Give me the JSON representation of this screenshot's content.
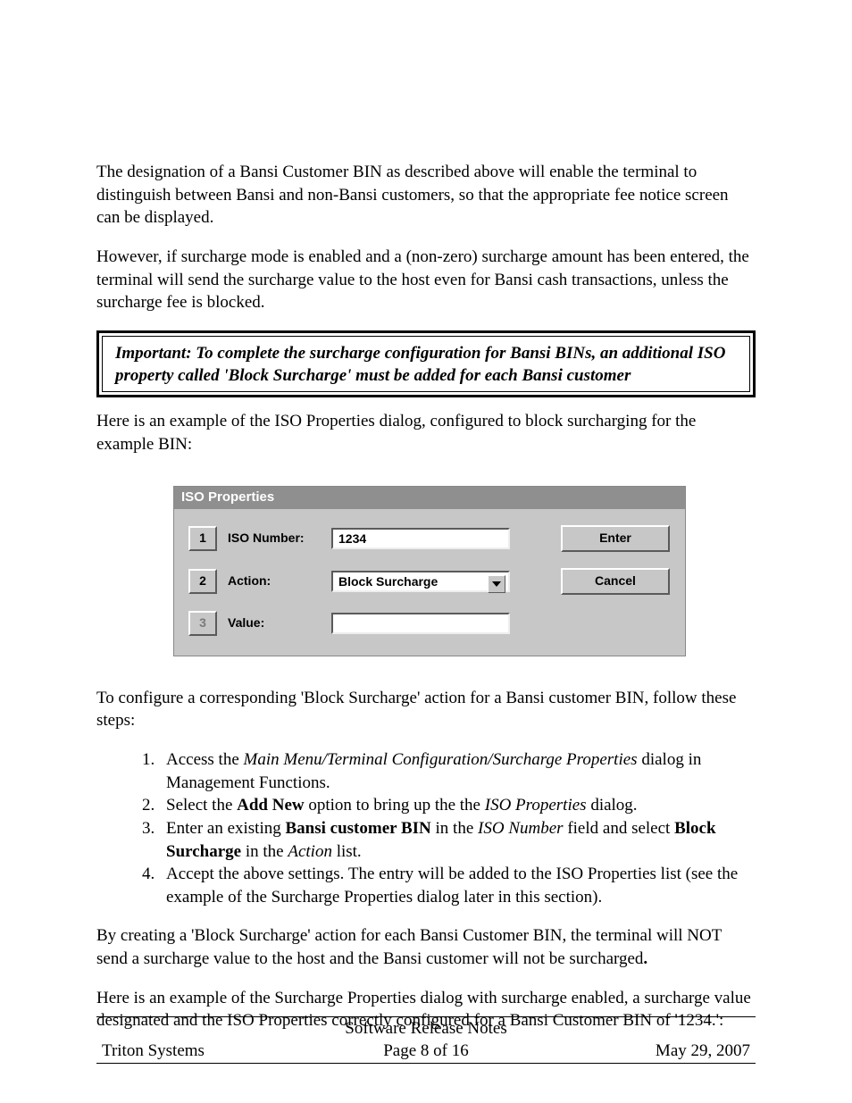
{
  "body": {
    "p1": "The designation of a Bansi Customer BIN as described above will enable the terminal to distinguish between Bansi and non-Bansi customers, so that the appropriate fee notice screen can be displayed.",
    "p2": "However, if surcharge mode is enabled and a (non-zero) surcharge amount has been entered, the terminal will send the surcharge value to the host even for Bansi cash transactions, unless the surcharge fee is blocked.",
    "callout": "Important: To complete the surcharge configuration for Bansi BINs, an additional ISO property called 'Block Surcharge' must be added for each Bansi customer",
    "p3": "Here is an example of the ISO Properties dialog, configured to block surcharging for the example BIN:",
    "p4": "To configure a corresponding 'Block Surcharge' action for a Bansi customer BIN, follow these steps:",
    "p5_a": "By creating a 'Block Surcharge' action for each Bansi Customer BIN, the terminal will NOT send a surcharge value to the host and the Bansi customer will not be surcharged",
    "p5_b": ".",
    "p6": "Here is an example of the Surcharge Properties dialog with surcharge enabled, a surcharge value designated and the ISO Properties correctly configured for a Bansi Customer BIN of '1234.':"
  },
  "steps": {
    "s1_a": "Access the ",
    "s1_b": "Main Menu/Terminal Configuration/Surcharge Properties",
    "s1_c": " dialog in Management Functions.",
    "s2_a": "Select the ",
    "s2_b": "Add New",
    "s2_c": " option to bring up the the ",
    "s2_d": "ISO Properties",
    "s2_e": " dialog.",
    "s3_a": "Enter an existing ",
    "s3_b": "Bansi customer BIN",
    "s3_c": " in the ",
    "s3_d": "ISO Number",
    "s3_e": " field and select ",
    "s3_f": "Block Surcharge",
    "s3_g": " in the ",
    "s3_h": "Action",
    "s3_i": " list.",
    "s4": "Accept the above settings. The entry will be added to the ISO Properties list (see the example of the Surcharge Properties dialog later in this section)."
  },
  "dialog": {
    "title": "ISO Properties",
    "row1": {
      "num": "1",
      "label": "ISO Number:",
      "value": "1234"
    },
    "row2": {
      "num": "2",
      "label": "Action:",
      "value": "Block Surcharge"
    },
    "row3": {
      "num": "3",
      "label": "Value:",
      "value": ""
    },
    "enter": "Enter",
    "cancel": "Cancel"
  },
  "footer": {
    "title": "Software Release Notes",
    "left": "Triton Systems",
    "center": "Page 8 of 16",
    "right": "May 29, 2007"
  }
}
